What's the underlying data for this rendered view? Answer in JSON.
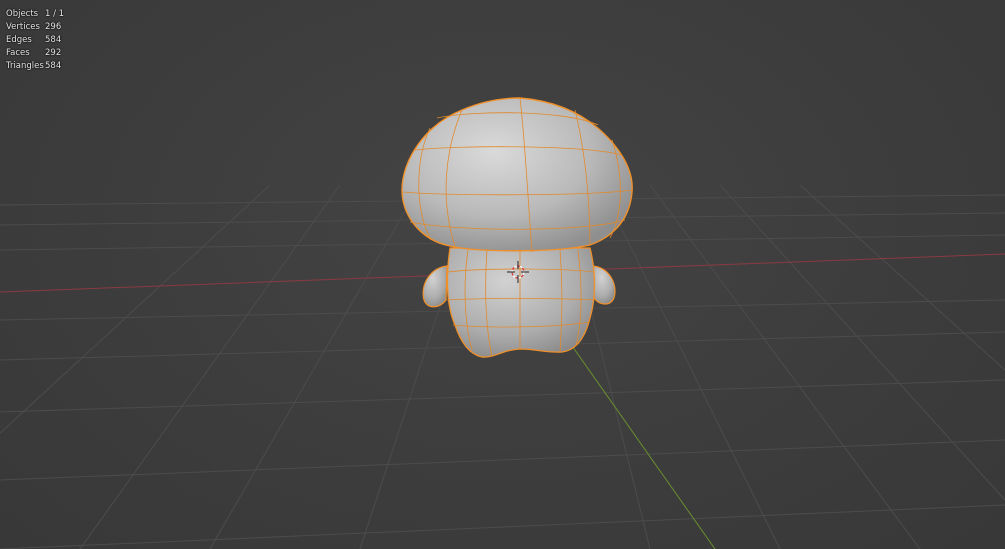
{
  "viewport": {
    "stats": [
      {
        "label": "Objects",
        "value": "1 / 1"
      },
      {
        "label": "Vertices",
        "value": "296"
      },
      {
        "label": "Edges",
        "value": "584"
      },
      {
        "label": "Faces",
        "value": "292"
      },
      {
        "label": "Triangles",
        "value": "584"
      }
    ],
    "colors": {
      "background": "#3d3d3d",
      "grid": "#4f4f4f",
      "x_axis": "#8a3a44",
      "y_axis": "#6a8f2e",
      "selection_outline": "#f0902a",
      "mesh_body": "#b8b8b8"
    },
    "selected_object": "mushroom-character-mesh",
    "cursor_icon": "3d-cursor-icon"
  }
}
